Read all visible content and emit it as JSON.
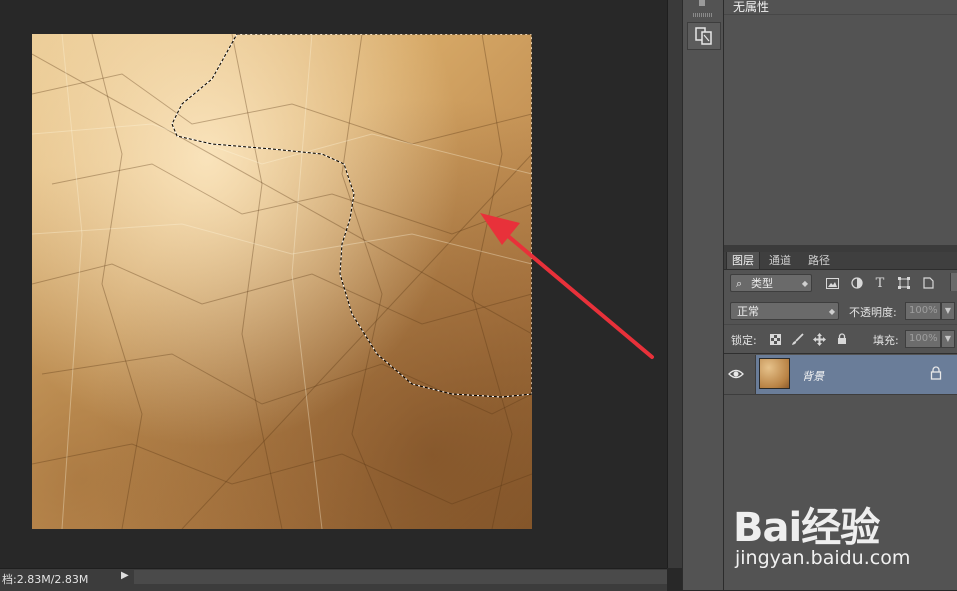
{
  "properties_panel": {
    "title": "无属性"
  },
  "layers_panel": {
    "tabs": [
      {
        "label": "图层",
        "active": true
      },
      {
        "label": "通道",
        "active": false
      },
      {
        "label": "路径",
        "active": false
      }
    ],
    "filter": {
      "value": "类型"
    },
    "filter_icons": [
      "image-filter-icon",
      "adjustment-filter-icon",
      "type-filter-icon",
      "shape-filter-icon",
      "smart-object-filter-icon"
    ],
    "blend_mode": "正常",
    "opacity_label": "不透明度:",
    "opacity_value": "100%",
    "lock_label": "锁定:",
    "lock_icons": [
      "lock-transparent-icon",
      "lock-image-icon",
      "lock-position-icon",
      "lock-all-icon"
    ],
    "fill_label": "填充:",
    "fill_value": "100%",
    "layers": [
      {
        "name": "背景",
        "visible": true,
        "locked": true,
        "selected": true
      }
    ]
  },
  "status_bar": {
    "text": "档:2.83M/2.83M"
  },
  "watermark": {
    "logo": "Bai经验",
    "url": "jingyan.baidu.com"
  },
  "colors": {
    "selected_layer": "#6a7d99",
    "annotation_arrow": "#e8313a"
  }
}
